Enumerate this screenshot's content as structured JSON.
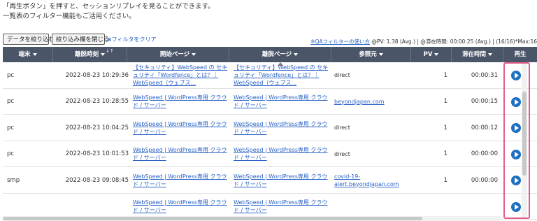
{
  "intro": {
    "line1": "「再生ボタン」を押すと、セッションリプレイを見ることができます。",
    "line2": "一覧表のフィルター機能もご活用ください。"
  },
  "toolbar": {
    "filter_label": "データを絞り込む",
    "close_label": "絞り込み欄を閉じる",
    "clear_label": "⊗フィルタをクリア",
    "qa_link": "※QAフィルターの使い方",
    "stats_text": " @PV: 1.38 (Avg.) | @滞在時間: 00:00:25 (Avg.) | (16/16)*Max:16"
  },
  "table": {
    "headers": [
      "端末",
      "離脱時刻",
      "開始ページ",
      "離脱ページ",
      "参照元",
      "PV",
      "滞在時間",
      "再生"
    ],
    "sort_icon": "↓↑",
    "rows": [
      {
        "device": "pc",
        "time": "2022-08-23 10:29:36",
        "start": "【セキュリティ】WebSpeed の セキュリティ「Wordfence」とは？｜WebSpeed（ウェブス...",
        "exit": "【セキュリティ】WebSpeed の セキュリティ「Wordfence」とは？｜WebSpeed（ウェブス...",
        "ref": "direct",
        "ref_link": false,
        "pv": "1",
        "stay": "00:00:31"
      },
      {
        "device": "pc",
        "time": "2022-08-23 10:28:55",
        "start": "WebSpeed | WordPress専用 クラウド / サーバー",
        "exit": "WebSpeed | WordPress専用 クラウド / サーバー",
        "ref": "beyondjapan.com",
        "ref_link": true,
        "pv": "1",
        "stay": "00:00:15"
      },
      {
        "device": "pc",
        "time": "2022-08-23 10:04:25",
        "start": "WebSpeed | WordPress専用 クラウド / サーバー",
        "exit": "WebSpeed | WordPress専用 クラウド / サーバー",
        "ref": "direct",
        "ref_link": false,
        "pv": "1",
        "stay": "00:00:12"
      },
      {
        "device": "pc",
        "time": "2022-08-23 10:01:53",
        "start": "WebSpeed | WordPress専用 クラウド / サーバー",
        "exit": "WebSpeed | WordPress専用 クラウド / サーバー",
        "ref": "direct",
        "ref_link": false,
        "pv": "1",
        "stay": "00:00:00"
      },
      {
        "device": "smp",
        "time": "2022-08-23 09:08:45",
        "start": "WebSpeed | WordPress専用 クラウド / サーバー",
        "exit": "WebSpeed | WordPress専用 クラウド / サーバー",
        "ref": "covid-19-alert.beyondjapan.com",
        "ref_link": true,
        "pv": "1",
        "stay": "00:00:00"
      },
      {
        "device": "",
        "time": "",
        "start": "WebSpeed | WordPress専用 クラウド / サーバー",
        "exit": "WebSpeed | WordPress専用 クラウド / サーバー",
        "ref": "",
        "ref_link": false,
        "pv": "",
        "stay": ""
      }
    ]
  },
  "colors": {
    "header_bg": "#4a5568",
    "link": "#2a63c5",
    "play": "#1d6fc1",
    "highlight": "#e35d8b"
  },
  "icons": {
    "play": "play-circle-icon",
    "caret": "caret-down-icon"
  }
}
